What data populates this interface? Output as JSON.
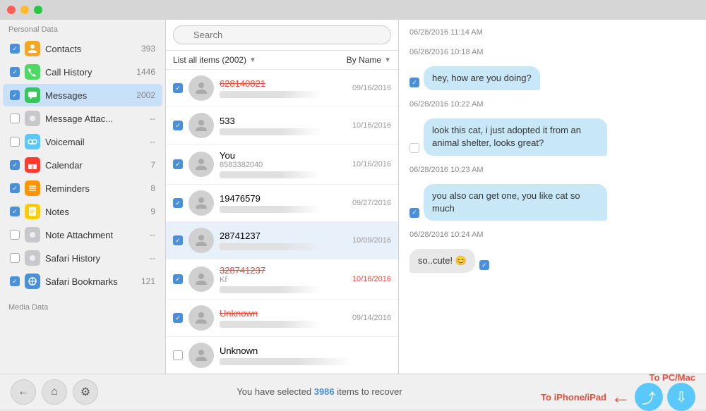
{
  "titlebar": {
    "btn1_color": "#ff5f57",
    "btn2_color": "#febc2e",
    "btn3_color": "#28c840"
  },
  "sidebar": {
    "personal_label": "Personal Data",
    "media_label": "Media Data",
    "items": [
      {
        "id": "contacts",
        "label": "Contacts",
        "count": "393",
        "checked": true,
        "icon_char": "👤",
        "icon_class": "icon-contacts"
      },
      {
        "id": "callhistory",
        "label": "Call History",
        "count": "1446",
        "checked": true,
        "icon_char": "📞",
        "icon_class": "icon-callhistory"
      },
      {
        "id": "messages",
        "label": "Messages",
        "count": "2002",
        "checked": true,
        "icon_char": "💬",
        "icon_class": "icon-messages",
        "active": true
      },
      {
        "id": "msgattach",
        "label": "Message Attac...",
        "count": "--",
        "checked": false,
        "icon_char": "📎",
        "icon_class": "icon-msgattach"
      },
      {
        "id": "voicemail",
        "label": "Voicemail",
        "count": "--",
        "checked": false,
        "icon_char": "📻",
        "icon_class": "icon-voicemail"
      },
      {
        "id": "calendar",
        "label": "Calendar",
        "count": "7",
        "checked": true,
        "icon_char": "3",
        "icon_class": "icon-calendar"
      },
      {
        "id": "reminders",
        "label": "Reminders",
        "count": "8",
        "checked": true,
        "icon_char": "≡",
        "icon_class": "icon-reminders"
      },
      {
        "id": "notes",
        "label": "Notes",
        "count": "9",
        "checked": true,
        "icon_char": "📝",
        "icon_class": "icon-notes"
      },
      {
        "id": "noteattach",
        "label": "Note Attachment",
        "count": "--",
        "checked": false,
        "icon_char": "📄",
        "icon_class": "icon-noteattach"
      },
      {
        "id": "safarihistory",
        "label": "Safari History",
        "count": "--",
        "checked": false,
        "icon_char": "◉",
        "icon_class": "icon-safari"
      },
      {
        "id": "safaribookmarks",
        "label": "Safari Bookmarks",
        "count": "121",
        "checked": true,
        "icon_char": "◉",
        "icon_class": "icon-safaribookmarks"
      }
    ]
  },
  "middle": {
    "search_placeholder": "Search",
    "list_label": "List all items (2002)",
    "sort_label": "By Name",
    "messages": [
      {
        "id": "m1",
        "name": "628140821",
        "name_deleted": true,
        "date": "09/16/2016",
        "date_red": false,
        "checked": true
      },
      {
        "id": "m2",
        "name": "533",
        "name_deleted": false,
        "date": "10/16/2016",
        "date_red": false,
        "checked": true
      },
      {
        "id": "m3",
        "name": "You",
        "name_sub": "8583382040",
        "name_deleted": false,
        "date": "10/16/2016",
        "date_red": false,
        "checked": true
      },
      {
        "id": "m4",
        "name": "19476579",
        "name_deleted": false,
        "date": "09/27/2016",
        "date_red": false,
        "checked": true
      },
      {
        "id": "m5",
        "name": "28741237",
        "name_deleted": false,
        "date": "10/09/2016",
        "date_red": false,
        "checked": true,
        "selected": true
      },
      {
        "id": "m6",
        "name": "328741237",
        "name_sub": "Kf",
        "name_deleted": true,
        "date": "10/16/2016",
        "date_red": true,
        "checked": true
      },
      {
        "id": "m7",
        "name": "Unknown",
        "name_deleted": true,
        "date": "09/14/2016",
        "date_red": false,
        "checked": true
      },
      {
        "id": "m8",
        "name": "Unknown",
        "name_deleted": false,
        "date": "",
        "date_red": false,
        "checked": false
      }
    ]
  },
  "chat": {
    "messages": [
      {
        "id": "c0",
        "type": "date",
        "text": "06/28/2016 11:14 AM"
      },
      {
        "id": "c1",
        "type": "date",
        "text": "06/28/2016 10:18 AM"
      },
      {
        "id": "c2",
        "type": "outgoing",
        "text": "hey, how are you doing?",
        "checked": true
      },
      {
        "id": "c3",
        "type": "date",
        "text": "06/28/2016 10:22 AM"
      },
      {
        "id": "c4",
        "type": "outgoing",
        "text": "look this cat, i just adopted it from an animal shelter, looks great?",
        "checked": false
      },
      {
        "id": "c5",
        "type": "date",
        "text": "06/28/2016 10:23 AM"
      },
      {
        "id": "c6",
        "type": "outgoing",
        "text": "you also can get one, you like cat so much",
        "checked": true
      },
      {
        "id": "c7",
        "type": "date",
        "text": "06/28/2016 10:24 AM"
      },
      {
        "id": "c8",
        "type": "incoming",
        "text": "so..cute! 😊",
        "checked": true
      }
    ]
  },
  "bottom": {
    "status_text": "You have selected ",
    "count": "3986",
    "status_suffix": " items to recover",
    "to_iphone_label": "To iPhone/iPad",
    "to_pc_label": "To PC/Mac"
  }
}
